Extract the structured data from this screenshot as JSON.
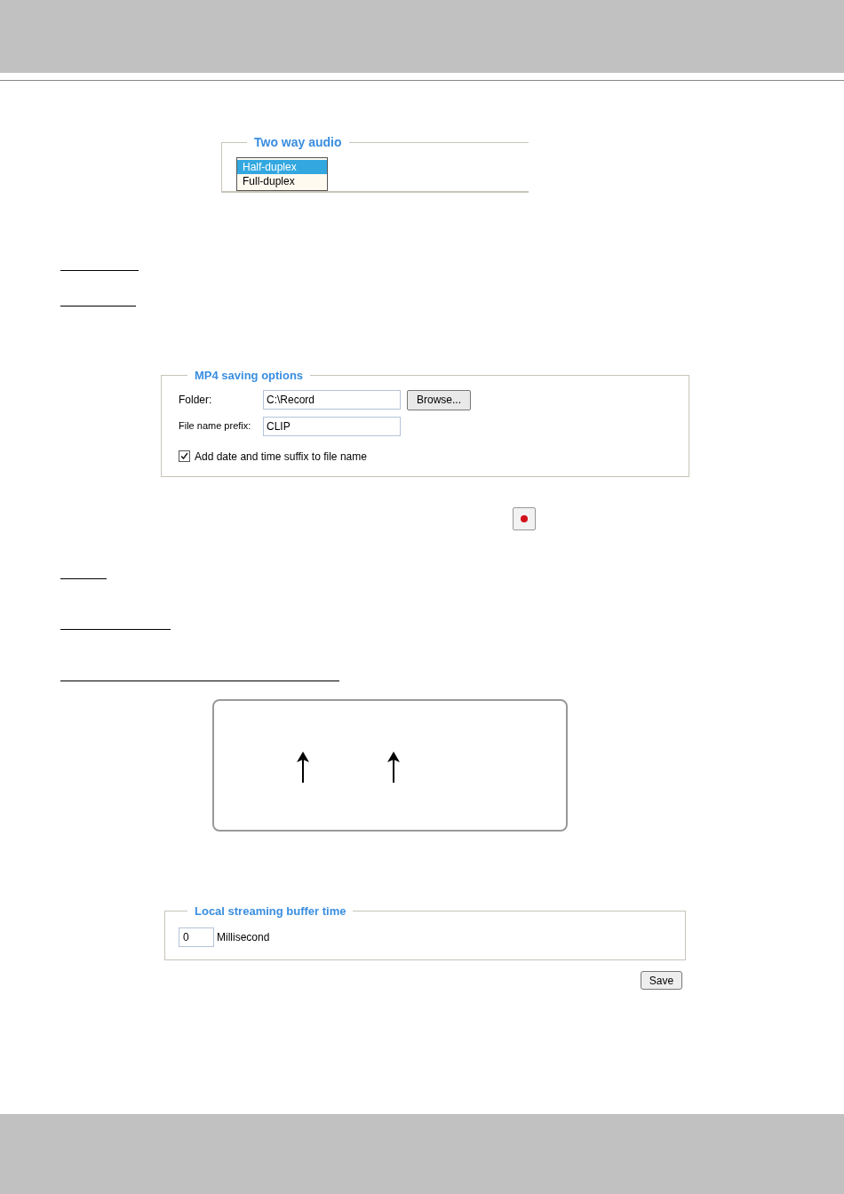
{
  "two_way_audio": {
    "title": "Two way audio",
    "options": [
      {
        "label": "Half-duplex",
        "selected": true
      },
      {
        "label": "Full-duplex",
        "selected": false
      }
    ]
  },
  "mp4_saving_options": {
    "title": "MP4 saving options",
    "folder": {
      "label": "Folder:",
      "value": "C:\\Record"
    },
    "browse_button": "Browse...",
    "prefix": {
      "label": "File name prefix:",
      "value": "CLIP"
    },
    "suffix_checkbox": {
      "label": "Add date and time suffix to file name",
      "checked": true
    }
  },
  "local_streaming_buffer_time": {
    "title": "Local streaming buffer time",
    "value": "0",
    "unit": "Millisecond"
  },
  "save_button": "Save"
}
